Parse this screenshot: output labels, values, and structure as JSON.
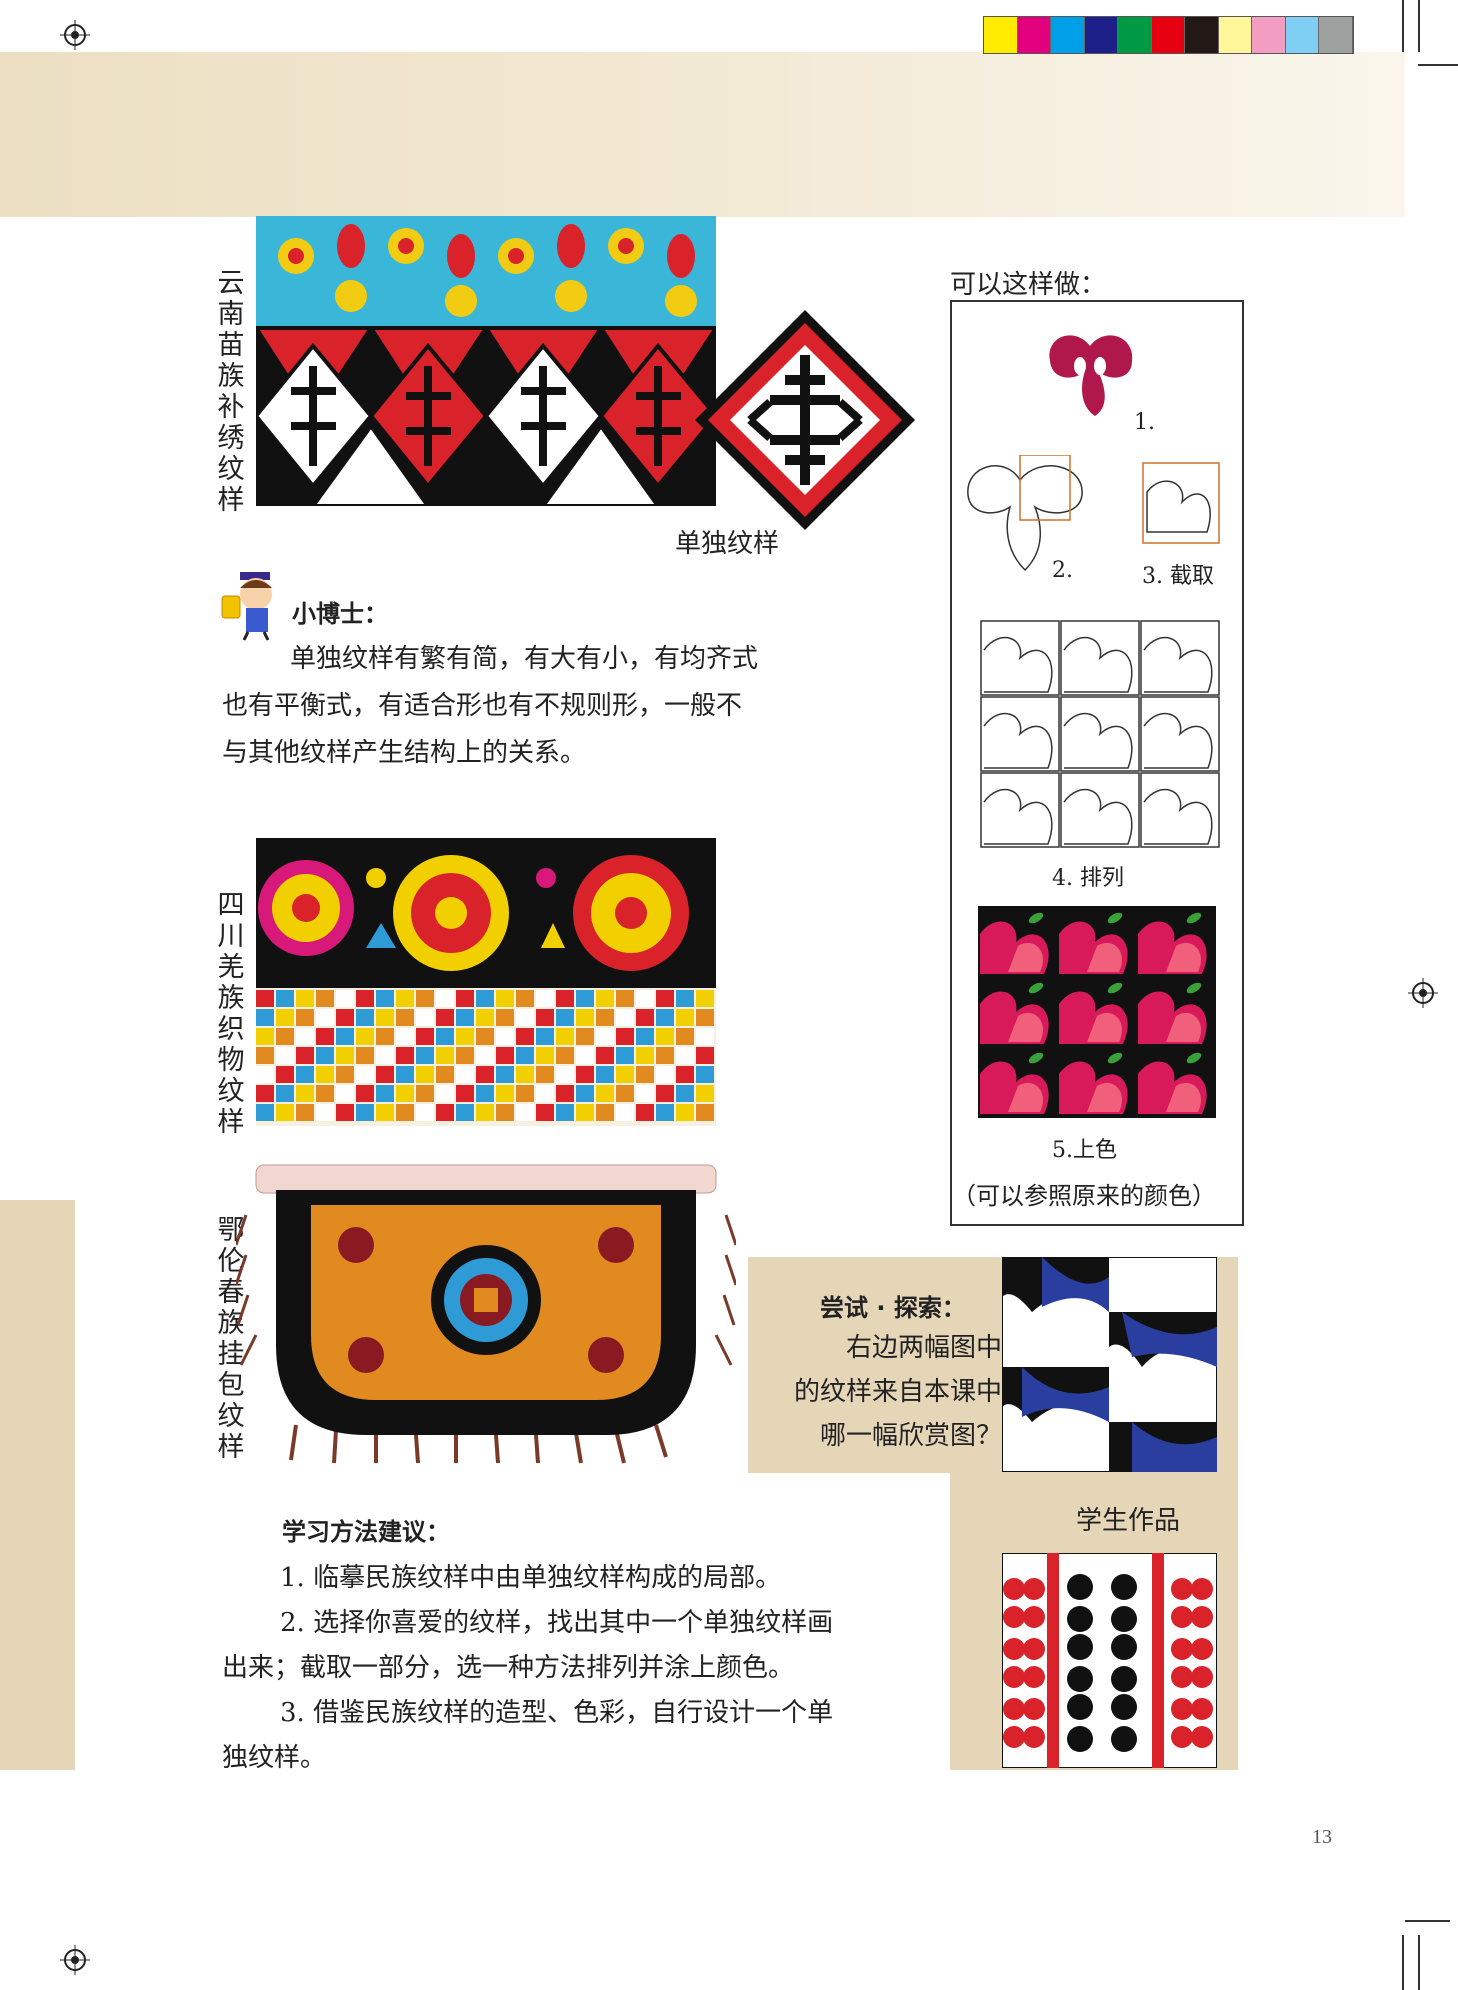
{
  "color_bar": [
    "#ffec00",
    "#e3007f",
    "#00a0e9",
    "#1d2088",
    "#009944",
    "#e60012",
    "#231815",
    "#fff799",
    "#f19ec2",
    "#7fcef4",
    "#9fa0a0"
  ],
  "labels": {
    "yunnan": "云南苗族补绣纹样",
    "sichuan": "四川羌族织物纹样",
    "oroqen": "鄂伦春族挂包纹样",
    "single_pattern": "单独纹样"
  },
  "doctor": {
    "title": "小博士：",
    "text": "单独纹样有繁有简，有大有小，有均齐式也有平衡式，有适合形也有不规则形，一般不与其他纹样产生结构上的关系。",
    "lines": [
      "单独纹样有繁有简，有大有小，有均齐式",
      "也有平衡式，有适合形也有不规则形，一般不",
      "与其他纹样产生结构上的关系。"
    ]
  },
  "steps": {
    "heading": "可以这样做：",
    "s1": "1.",
    "s2": "2.",
    "s3": "3. 截取",
    "s4": "4. 排列",
    "s5": "5.上色",
    "s5_note": "（可以参照原来的颜色）"
  },
  "explore": {
    "title": "尝试 · 探索：",
    "lines": [
      "右边两幅图中",
      "的纹样来自本课中",
      "哪一幅欣赏图？"
    ]
  },
  "student_work": "学生作品",
  "study": {
    "title": "学习方法建议：",
    "lines": [
      "1. 临摹民族纹样中由单独纹样构成的局部。",
      "2. 选择你喜爱的纹样，找出其中一个单独纹样画",
      "出来；截取一部分，选一种方法排列并涂上颜色。",
      "3. 借鉴民族纹样的造型、色彩，自行设计一个单",
      "独纹样。"
    ]
  },
  "page_number": "13"
}
